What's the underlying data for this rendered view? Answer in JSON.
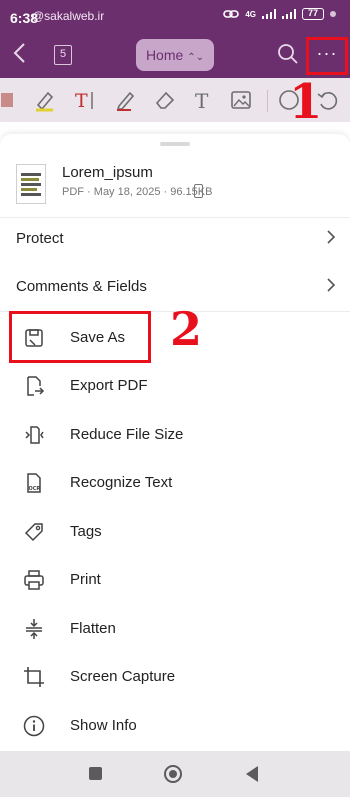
{
  "status_bar": {
    "time": "6:38",
    "watermark": "@sakalweb.ir",
    "network": "4G",
    "battery": "77"
  },
  "app_bar": {
    "page_count": "5",
    "view_mode": "Home",
    "more_label": "···"
  },
  "annotations": {
    "step1": "1",
    "step2": "2"
  },
  "file": {
    "name": "Lorem_ipsum",
    "meta": "PDF · May 18, 2025 · 96.15KB"
  },
  "sections": [
    {
      "label": "Protect"
    },
    {
      "label": "Comments & Fields"
    }
  ],
  "menu": [
    {
      "label": "Save As",
      "icon": "save-icon"
    },
    {
      "label": "Export PDF",
      "icon": "export-icon"
    },
    {
      "label": "Reduce File Size",
      "icon": "compress-icon"
    },
    {
      "label": "Recognize Text",
      "icon": "ocr-icon"
    },
    {
      "label": "Tags",
      "icon": "tag-icon"
    },
    {
      "label": "Print",
      "icon": "printer-icon"
    },
    {
      "label": "Flatten",
      "icon": "flatten-icon"
    },
    {
      "label": "Screen Capture",
      "icon": "crop-icon"
    },
    {
      "label": "Show Info",
      "icon": "info-icon"
    }
  ],
  "colors": {
    "brand": "#6c2f6e",
    "annotation": "#e8101d"
  }
}
